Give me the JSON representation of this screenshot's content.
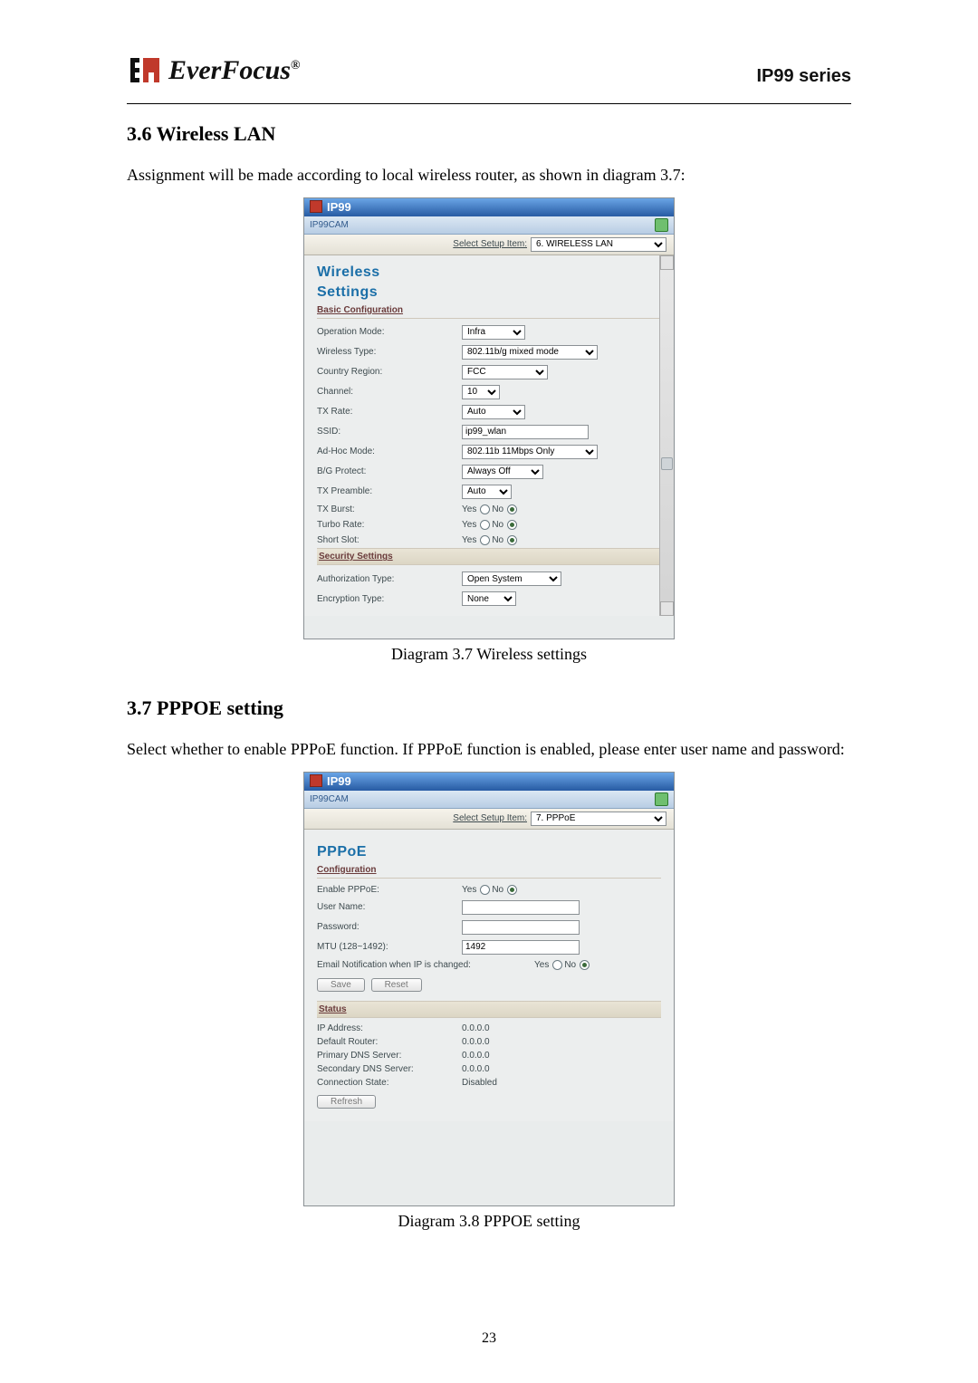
{
  "header": {
    "logo_text": "EverFocus",
    "logo_reg": "®",
    "series": "IP99 series"
  },
  "section1": {
    "heading": "3.6 Wireless LAN",
    "body": "Assignment will be made according to local wireless router, as shown in diagram 3.7:"
  },
  "shot1": {
    "title": "IP99",
    "breadcrumb": "IP99CAM",
    "setup_label": "Select Setup Item:",
    "setup_value": "6. WIRELESS LAN",
    "panel_title1": "Wireless",
    "panel_title2": "Settings",
    "basic_label": "Basic Configuration",
    "rows": [
      {
        "label": "Operation Mode:",
        "type": "select",
        "value": "Infra"
      },
      {
        "label": "Wireless Type:",
        "type": "select",
        "value": "802.11b/g mixed mode"
      },
      {
        "label": "Country Region:",
        "type": "select",
        "value": "FCC"
      },
      {
        "label": "Channel:",
        "type": "select",
        "value": "10"
      },
      {
        "label": "TX Rate:",
        "type": "select",
        "value": "Auto"
      },
      {
        "label": "SSID:",
        "type": "input",
        "value": "ip99_wlan"
      },
      {
        "label": "Ad-Hoc Mode:",
        "type": "select",
        "value": "802.11b 11Mbps Only"
      },
      {
        "label": "B/G Protect:",
        "type": "select",
        "value": "Always Off"
      },
      {
        "label": "TX Preamble:",
        "type": "select",
        "value": "Auto"
      },
      {
        "label": "TX Burst:",
        "type": "radio",
        "yes": "Yes",
        "no": "No",
        "checked": "no"
      },
      {
        "label": "Turbo Rate:",
        "type": "radio",
        "yes": "Yes",
        "no": "No",
        "checked": "no"
      },
      {
        "label": "Short Slot:",
        "type": "radio",
        "yes": "Yes",
        "no": "No",
        "checked": "no"
      }
    ],
    "security_label": "Security Settings",
    "sec_rows": [
      {
        "label": "Authorization Type:",
        "type": "select",
        "value": "Open System"
      },
      {
        "label": "Encryption Type:",
        "type": "select",
        "value": "None"
      }
    ]
  },
  "caption1": "Diagram 3.7 Wireless settings",
  "section2": {
    "heading": "3.7 PPPOE setting",
    "body": "Select whether to enable PPPoE function. If PPPoE function is enabled, please enter user name and password:"
  },
  "shot2": {
    "title": "IP99",
    "breadcrumb": "IP99CAM",
    "setup_label": "Select Setup Item:",
    "setup_value": "7. PPPoE",
    "panel_title": "PPPoE",
    "config_label": "Configuration",
    "rows": [
      {
        "label": "Enable PPPoE:",
        "type": "radio",
        "yes": "Yes",
        "no": "No",
        "checked": "no"
      },
      {
        "label": "User Name:",
        "type": "input",
        "value": ""
      },
      {
        "label": "Password:",
        "type": "input",
        "value": ""
      },
      {
        "label": "MTU (128~1492):",
        "type": "input",
        "value": "1492"
      },
      {
        "label": "Email Notification when IP is changed:",
        "type": "radio",
        "yes": "Yes",
        "no": "No",
        "checked": "no"
      }
    ],
    "buttons": {
      "save": "Save",
      "reset": "Reset"
    },
    "status_label": "Status",
    "status": [
      {
        "label": "IP Address:",
        "value": "0.0.0.0"
      },
      {
        "label": "Default Router:",
        "value": "0.0.0.0"
      },
      {
        "label": "Primary DNS Server:",
        "value": "0.0.0.0"
      },
      {
        "label": "Secondary DNS Server:",
        "value": "0.0.0.0"
      },
      {
        "label": "Connection State:",
        "value": "Disabled"
      }
    ],
    "refresh": "Refresh"
  },
  "caption2": "Diagram 3.8 PPPOE setting",
  "page_number": "23"
}
